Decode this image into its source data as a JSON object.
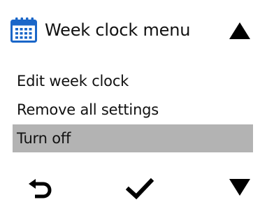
{
  "header": {
    "title": "Week clock menu",
    "icon": "calendar-icon"
  },
  "menu": {
    "items": [
      {
        "label": "Edit week clock",
        "selected": false
      },
      {
        "label": "Remove all settings",
        "selected": false
      },
      {
        "label": "Turn off",
        "selected": true
      }
    ]
  },
  "nav": {
    "back_icon": "back-arrow-icon",
    "confirm_icon": "checkmark-icon",
    "scroll_up_icon": "triangle-up-icon",
    "scroll_down_icon": "triangle-down-icon"
  },
  "colors": {
    "accent": "#1a66c8",
    "selection": "#b3b3b3",
    "text": "#111111",
    "background": "#ffffff"
  }
}
